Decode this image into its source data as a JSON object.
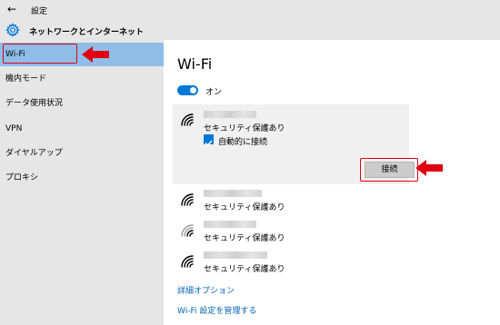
{
  "window": {
    "title": "設定"
  },
  "header": {
    "title": "ネットワークとインターネット"
  },
  "sidebar": {
    "items": [
      {
        "label": "Wi-Fi",
        "selected": true
      },
      {
        "label": "機内モード"
      },
      {
        "label": "データ使用状況"
      },
      {
        "label": "VPN"
      },
      {
        "label": "ダイヤルアップ"
      },
      {
        "label": "プロキシ"
      }
    ]
  },
  "main": {
    "title": "Wi-Fi",
    "toggle": {
      "state_label": "オン",
      "on": true
    },
    "networks": [
      {
        "security": "セキュリティ保護あり",
        "auto_connect_label": "自動的に接続",
        "auto_connect_checked": true,
        "connect_label": "接続",
        "expanded": true
      },
      {
        "security": "セキュリティ保護あり"
      },
      {
        "security": "セキュリティ保護あり"
      },
      {
        "security": "セキュリティ保護あり"
      }
    ],
    "links": {
      "advanced": "詳細オプション",
      "manage": "Wi-Fi 設定を管理する"
    }
  },
  "colors": {
    "accent": "#0078d7",
    "selected_nav": "#8fbde8",
    "annotation_red": "#e00012",
    "link": "#0063b1"
  },
  "icons": [
    "back-arrow-icon",
    "gear-icon",
    "wifi-signal-icon",
    "checkmark-icon",
    "red-arrow-icon"
  ]
}
